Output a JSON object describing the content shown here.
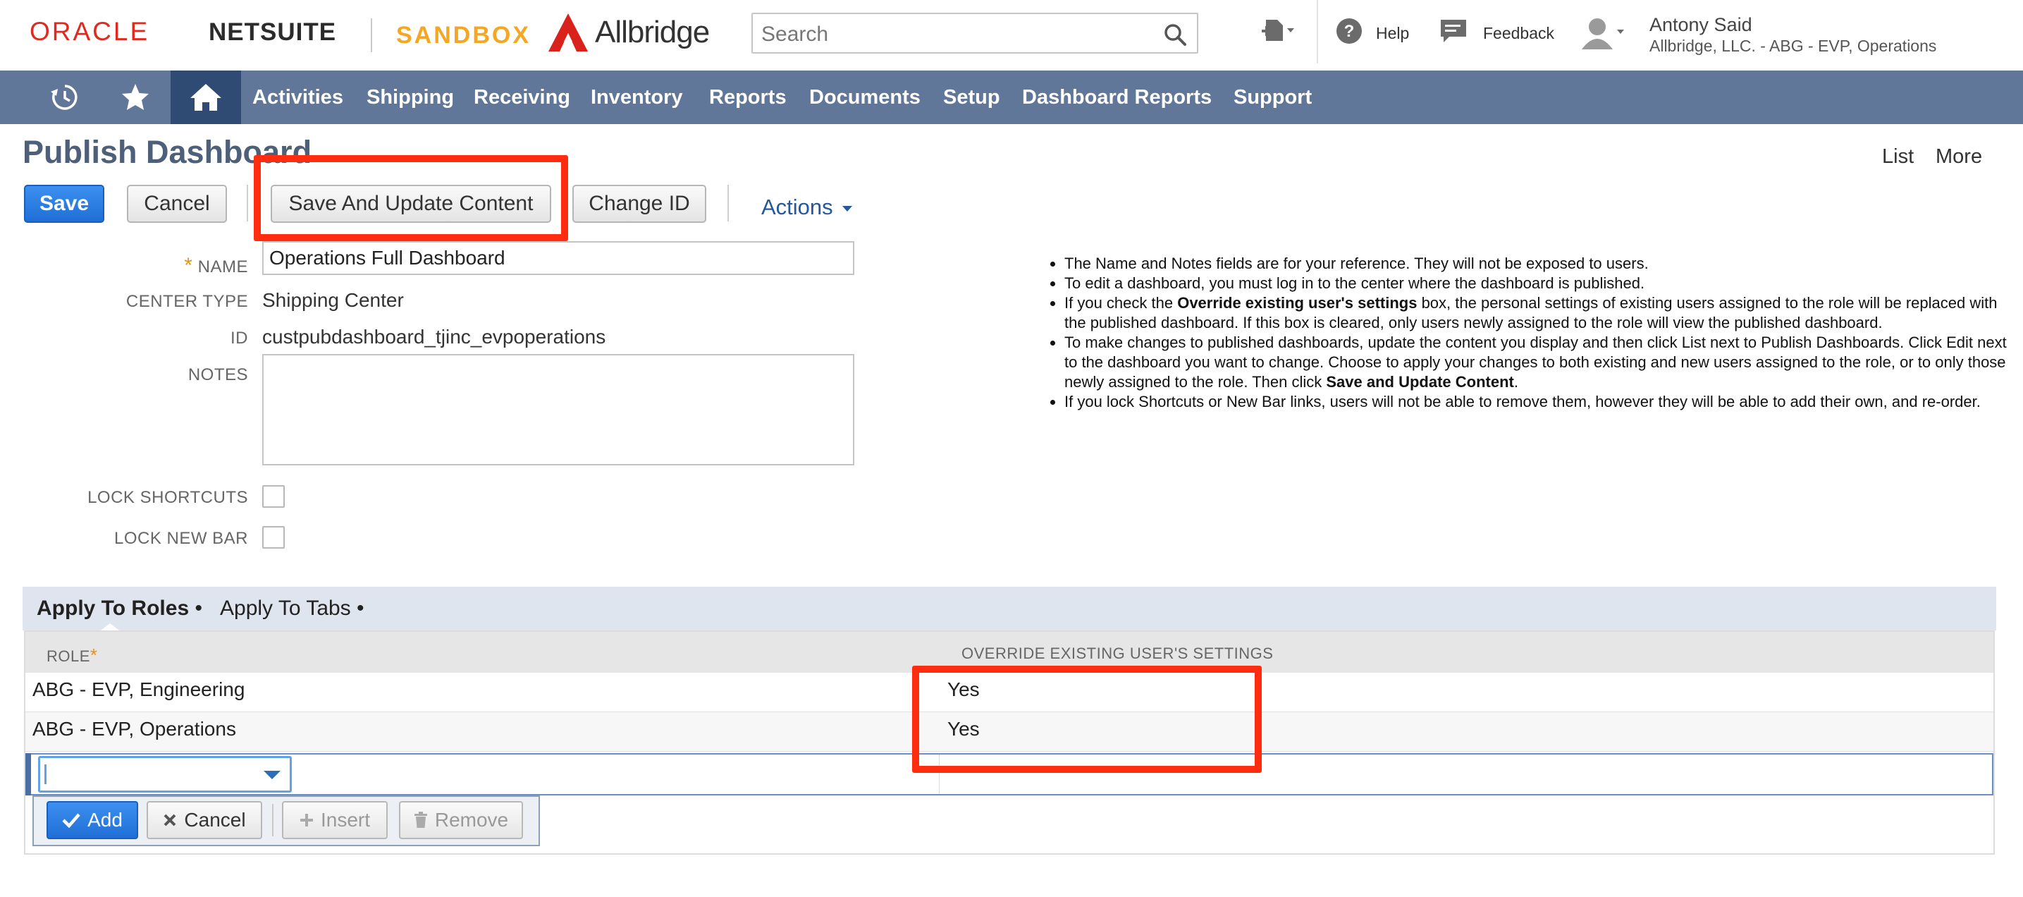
{
  "header": {
    "oracle_logo": "ORACLE",
    "netsuite_logo": "NETSUITE",
    "sandbox_label": "SANDBOX",
    "company_logo": "Allbridge",
    "search_placeholder": "Search",
    "help_label": "Help",
    "feedback_label": "Feedback",
    "user_name": "Antony Said",
    "user_role": "Allbridge, LLC. - ABG - EVP, Operations"
  },
  "nav": {
    "items": [
      "Activities",
      "Shipping",
      "Receiving",
      "Inventory",
      "Reports",
      "Documents",
      "Setup",
      "Dashboard Reports",
      "Support"
    ]
  },
  "page": {
    "title": "Publish Dashboard",
    "list_link": "List",
    "more_link": "More"
  },
  "toolbar": {
    "save": "Save",
    "cancel": "Cancel",
    "save_update": "Save And Update Content",
    "change_id": "Change ID",
    "actions": "Actions"
  },
  "form": {
    "name_label": "NAME",
    "name_value": "Operations Full Dashboard",
    "center_type_label": "CENTER TYPE",
    "center_type_value": "Shipping Center",
    "id_label": "ID",
    "id_value": "custpubdashboard_tjinc_evpoperations",
    "notes_label": "NOTES",
    "notes_value": "",
    "lock_shortcuts_label": "LOCK SHORTCUTS",
    "lock_shortcuts_checked": false,
    "lock_newbar_label": "LOCK NEW BAR",
    "lock_newbar_checked": false
  },
  "help": {
    "item1": "The Name and Notes fields are for your reference. They will not be exposed to users.",
    "item2": "To edit a dashboard, you must log in to the center where the dashboard is published.",
    "item3_pre": "If you check the ",
    "item3_bold": "Override existing user's settings",
    "item3_post": " box, the personal settings of existing users assigned to the role will be replaced with the published dashboard. If this box is cleared, only users newly assigned to the role will view the published dashboard.",
    "item4_pre": "To make changes to published dashboards, update the content you display and then click List next to Publish Dashboards. Click Edit next to the dashboard you want to change. Choose to apply your changes to both existing and new users assigned to the role, or to only those newly assigned to the role. Then click ",
    "item4_bold": "Save and Update Content",
    "item4_post": ".",
    "item5": "If you lock Shortcuts or New Bar links, users will not be able to remove them, however they will be able to add their own, and re-order."
  },
  "sublist": {
    "tab_roles": "Apply To Roles",
    "tab_tabs": "Apply To Tabs",
    "tab_bullet": "•",
    "col_role": "ROLE",
    "col_override": "OVERRIDE EXISTING USER'S SETTINGS",
    "rows": [
      {
        "role": "ABG - EVP, Engineering",
        "override": "Yes"
      },
      {
        "role": "ABG - EVP, Operations",
        "override": "Yes"
      }
    ],
    "new_role_value": "",
    "add": "Add",
    "cancel": "Cancel",
    "insert": "Insert",
    "remove": "Remove"
  },
  "colors": {
    "nav_bg": "#607799",
    "nav_active": "#2f4a73",
    "primary_button": "#1f6fd6",
    "highlight_annotation": "#ff2d0f",
    "title_color": "#4d5f79"
  }
}
